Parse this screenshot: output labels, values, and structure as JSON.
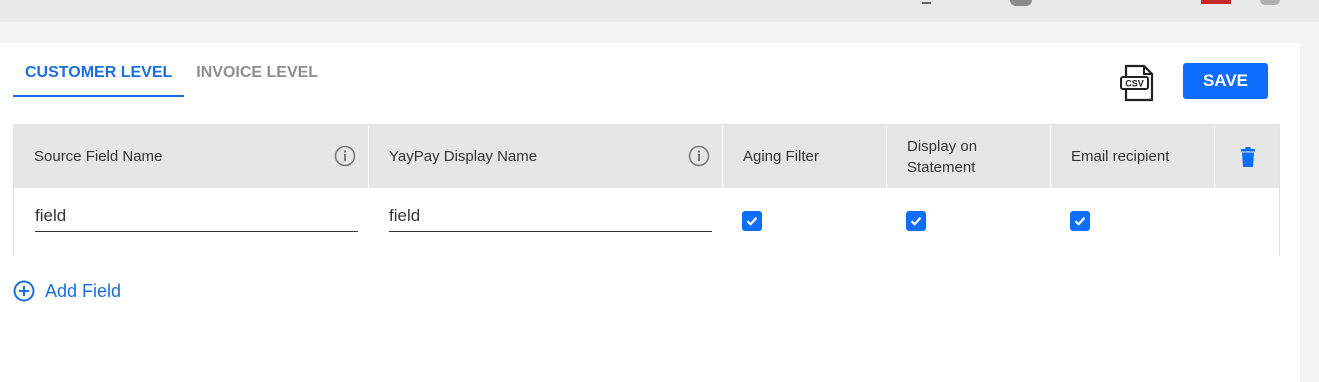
{
  "tabs": [
    {
      "label": "CUSTOMER LEVEL",
      "active": true
    },
    {
      "label": "INVOICE LEVEL",
      "active": false
    }
  ],
  "toolbar": {
    "csv_icon": "csv-file-icon",
    "save_label": "SAVE"
  },
  "table": {
    "headers": {
      "source_field_name": "Source Field Name",
      "display_name": "YayPay Display Name",
      "aging_filter": "Aging Filter",
      "display_on_statement": "Display on Statement",
      "email_recipient": "Email recipient"
    },
    "rows": [
      {
        "source_field_name": "field",
        "display_name": "field",
        "aging_filter": true,
        "display_on_statement": true,
        "email_recipient": true
      }
    ]
  },
  "add_field_label": "Add Field",
  "colors": {
    "accent": "#1a6fe0",
    "button": "#0d6efd",
    "header_bg": "#e6e6e6"
  }
}
